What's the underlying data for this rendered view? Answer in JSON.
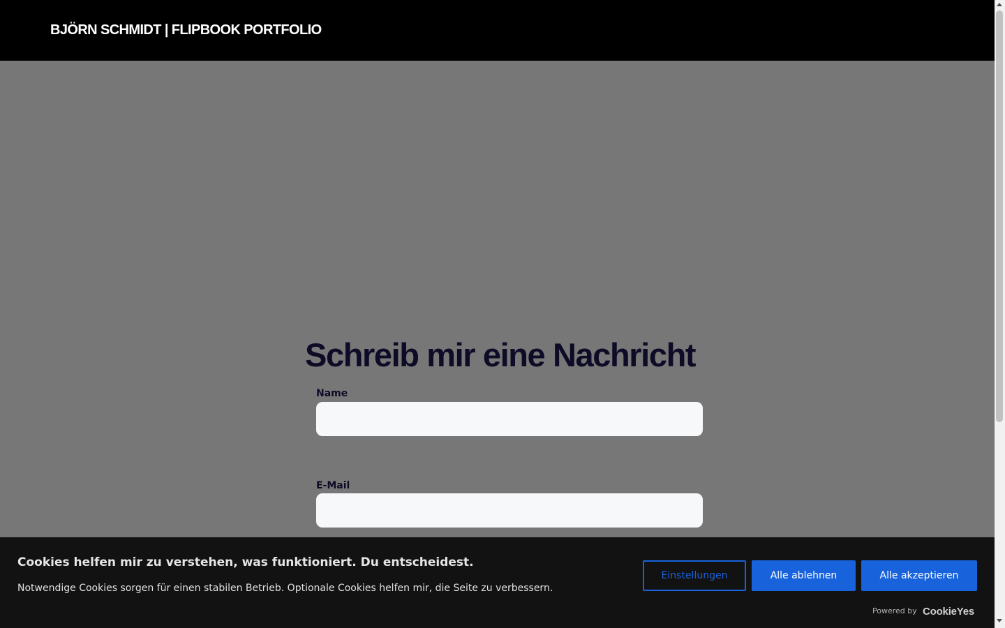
{
  "header": {
    "site_title": "BJÖRN SCHMIDT | FLIPBOOK PORTFOLIO"
  },
  "contact_form": {
    "heading": "Schreib mir eine Nachricht",
    "name_label": "Name",
    "name_value": "",
    "email_label": "E-Mail",
    "email_value": ""
  },
  "cookie_banner": {
    "title": "Cookies helfen mir zu verstehen, was funktioniert. Du entscheidest.",
    "text": "Notwendige Cookies sorgen für einen stabilen Betrieb. Optionale Cookies helfen mir, die Seite zu verbessern.",
    "settings_label": "Einstellungen",
    "reject_label": "Alle ablehnen",
    "accept_label": "Alle akzeptieren",
    "powered_by_label": "Powered by",
    "brand": "CookieYes"
  },
  "colors": {
    "header_bg": "#000000",
    "page_overlay": "#777777",
    "heading_text": "#0d0b26",
    "banner_bg": "#121212",
    "button_accent": "#1863dc"
  }
}
